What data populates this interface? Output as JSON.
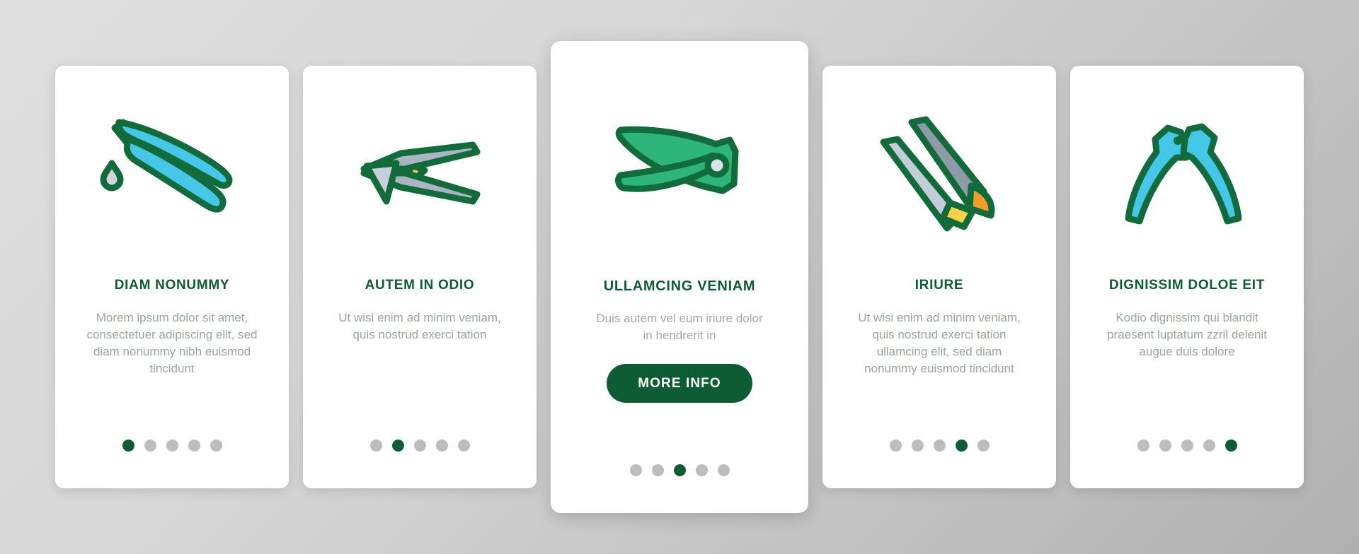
{
  "theme": {
    "brand_green": "#0d5c33",
    "accent_cyan": "#45c8e8",
    "accent_green": "#2eb57a",
    "accent_blue": "#5b8fe0",
    "accent_orange": "#f59b2a",
    "accent_yellow": "#f7d14a",
    "accent_steel": "#aab5c4",
    "dot_inactive": "#bdbdbd",
    "card_bg": "#ffffff",
    "body_text": "#9aa79a"
  },
  "cards": [
    {
      "icon_name": "pliers-with-drop-icon",
      "title": "DIAM NONUMMY",
      "body": "Morem ipsum dolor sit amet, consectetuer adipiscing elit, sed diam nonummy nibh euismod tincidunt",
      "dots": {
        "count": 5,
        "active_index": 0
      },
      "featured": false
    },
    {
      "icon_name": "end-cutting-nipper-icon",
      "title": "AUTEM IN ODIO",
      "body": "Ut wisi enim ad minim veniam, quis nostrud exerci tation",
      "dots": {
        "count": 5,
        "active_index": 1
      },
      "featured": false
    },
    {
      "icon_name": "pruning-shears-icon",
      "title": "ULLAMCING VENIAM",
      "body": "Duis autem vel eum iriure dolor in hendrerit in",
      "cta_label": "MORE INFO",
      "dots": {
        "count": 5,
        "active_index": 2
      },
      "featured": true
    },
    {
      "icon_name": "tongs-tweezers-icon",
      "title": "IRIURE",
      "body": "Ut wisi enim ad minim veniam, quis nostrud exerci tation ullamcing elit, sed diam nonummy euismod tincidunt",
      "dots": {
        "count": 5,
        "active_index": 3
      },
      "featured": false
    },
    {
      "icon_name": "nail-nipper-pincers-icon",
      "title": "DIGNISSIM DOLOE EIT",
      "body": "Kodio dignissim qui blandit praesent luptatum zzril delenit augue duis dolore",
      "dots": {
        "count": 5,
        "active_index": 4
      },
      "featured": false
    }
  ]
}
